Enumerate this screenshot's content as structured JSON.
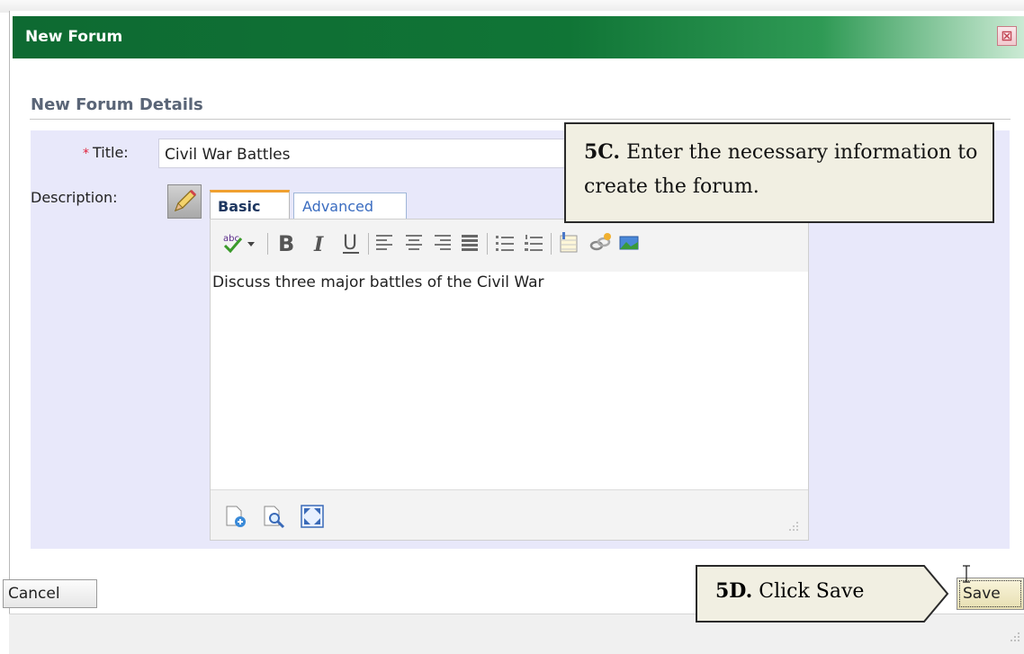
{
  "dialog": {
    "title": "New Forum",
    "close_symbol": "⊠"
  },
  "section": {
    "heading": "New Forum Details"
  },
  "form": {
    "required_marker": "*",
    "title_label": "Title:",
    "title_value": "Civil War Battles",
    "description_label": "Description:",
    "description_text": "Discuss three major battles of the Civil War"
  },
  "editor": {
    "tabs": [
      {
        "label": "Basic",
        "active": true
      },
      {
        "label": "Advanced",
        "active": false
      }
    ],
    "toolbar_icons": [
      "spellcheck-icon",
      "bold-icon",
      "italic-icon",
      "underline-icon",
      "align-left-icon",
      "align-center-icon",
      "align-right-icon",
      "justify-icon",
      "bullet-list-icon",
      "numbered-list-icon",
      "insert-table-icon",
      "insert-link-icon",
      "insert-image-icon"
    ],
    "footer_icons": [
      "insert-page-icon",
      "preview-icon",
      "fullscreen-icon"
    ]
  },
  "callouts": {
    "c5_number": "5C.",
    "c5_text": " Enter the necessary information to create the forum.",
    "d5_number": "5D.",
    "d5_text": " Click Save"
  },
  "buttons": {
    "cancel": "Cancel",
    "save": "Save"
  },
  "colors": {
    "titlebar": "#107536",
    "form_background": "#e8e8fa",
    "callout_background": "#f1efe2",
    "required": "#e0213b"
  }
}
